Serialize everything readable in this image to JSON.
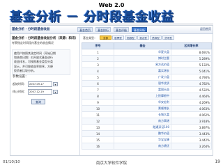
{
  "slide": {
    "top_label": "Web 2.0",
    "title": "基金分析 － 分时段基金收益",
    "footer_left": "01/10/10",
    "footer_center": "南京大学软件学院",
    "page_number": "19"
  },
  "nav": {
    "site_title": "基金分析 · 分时段基金收益",
    "tabs": [
      "基金首页",
      "基金排行",
      "基金评级",
      "基金分析"
    ],
    "active_tab": "基金分析",
    "right_link": "返回首页"
  },
  "left": {
    "title": "基金分析 - 分时段基金收益分析（来源：和讯）",
    "intro": "考察指定时间段内基金的收益情况",
    "desc_lines": [
      "使用户按照其选定时间（开始日期",
      "和结束日期）对开放式基金进行",
      "收益排名，可按照基金类型分类",
      "显示，并可按收益率排序，方便",
      "投资者比较分析。"
    ],
    "param_label": "参数设置：",
    "start_label": "起始时间：",
    "start_value": "2007-09-17",
    "end_label": "终止时间：",
    "end_value": "2007-12-19",
    "query_button": "查询"
  },
  "filter": {
    "label": "基金类型：",
    "tabs": [
      "全部",
      "股票型",
      "指数型",
      "混合型",
      "债券型",
      "货币型"
    ],
    "active": "全部"
  },
  "table": {
    "headers": [
      "序号",
      "基金",
      "区间增长率"
    ],
    "rows": [
      [
        "1",
        "华夏大盘",
        "8.691%"
      ],
      [
        "2",
        "博时主题",
        "5.289%"
      ],
      [
        "3",
        "易方达价值",
        "5.132%"
      ],
      [
        "4",
        "嘉实增长",
        "5.041%"
      ],
      [
        "5",
        "广发小盘",
        "4.790%"
      ],
      [
        "6",
        "银华优质",
        "4.782%"
      ],
      [
        "7",
        "富国天益",
        "4.532%"
      ],
      [
        "8",
        "上投摩根中",
        "4.464%"
      ],
      [
        "9",
        "华安宏利",
        "4.269%"
      ],
      [
        "10",
        "景顺增长",
        "4.063%"
      ],
      [
        "11",
        "长城久富",
        "4.062%"
      ],
      [
        "12",
        "南方高增",
        "3.918%"
      ],
      [
        "13",
        "融通深证100",
        "3.897%"
      ],
      [
        "14",
        "鹏华价值",
        "3.443%"
      ],
      [
        "15",
        "华宝宝康",
        "3.442%"
      ],
      [
        "16",
        "南方绩优",
        "3.264%"
      ]
    ]
  }
}
